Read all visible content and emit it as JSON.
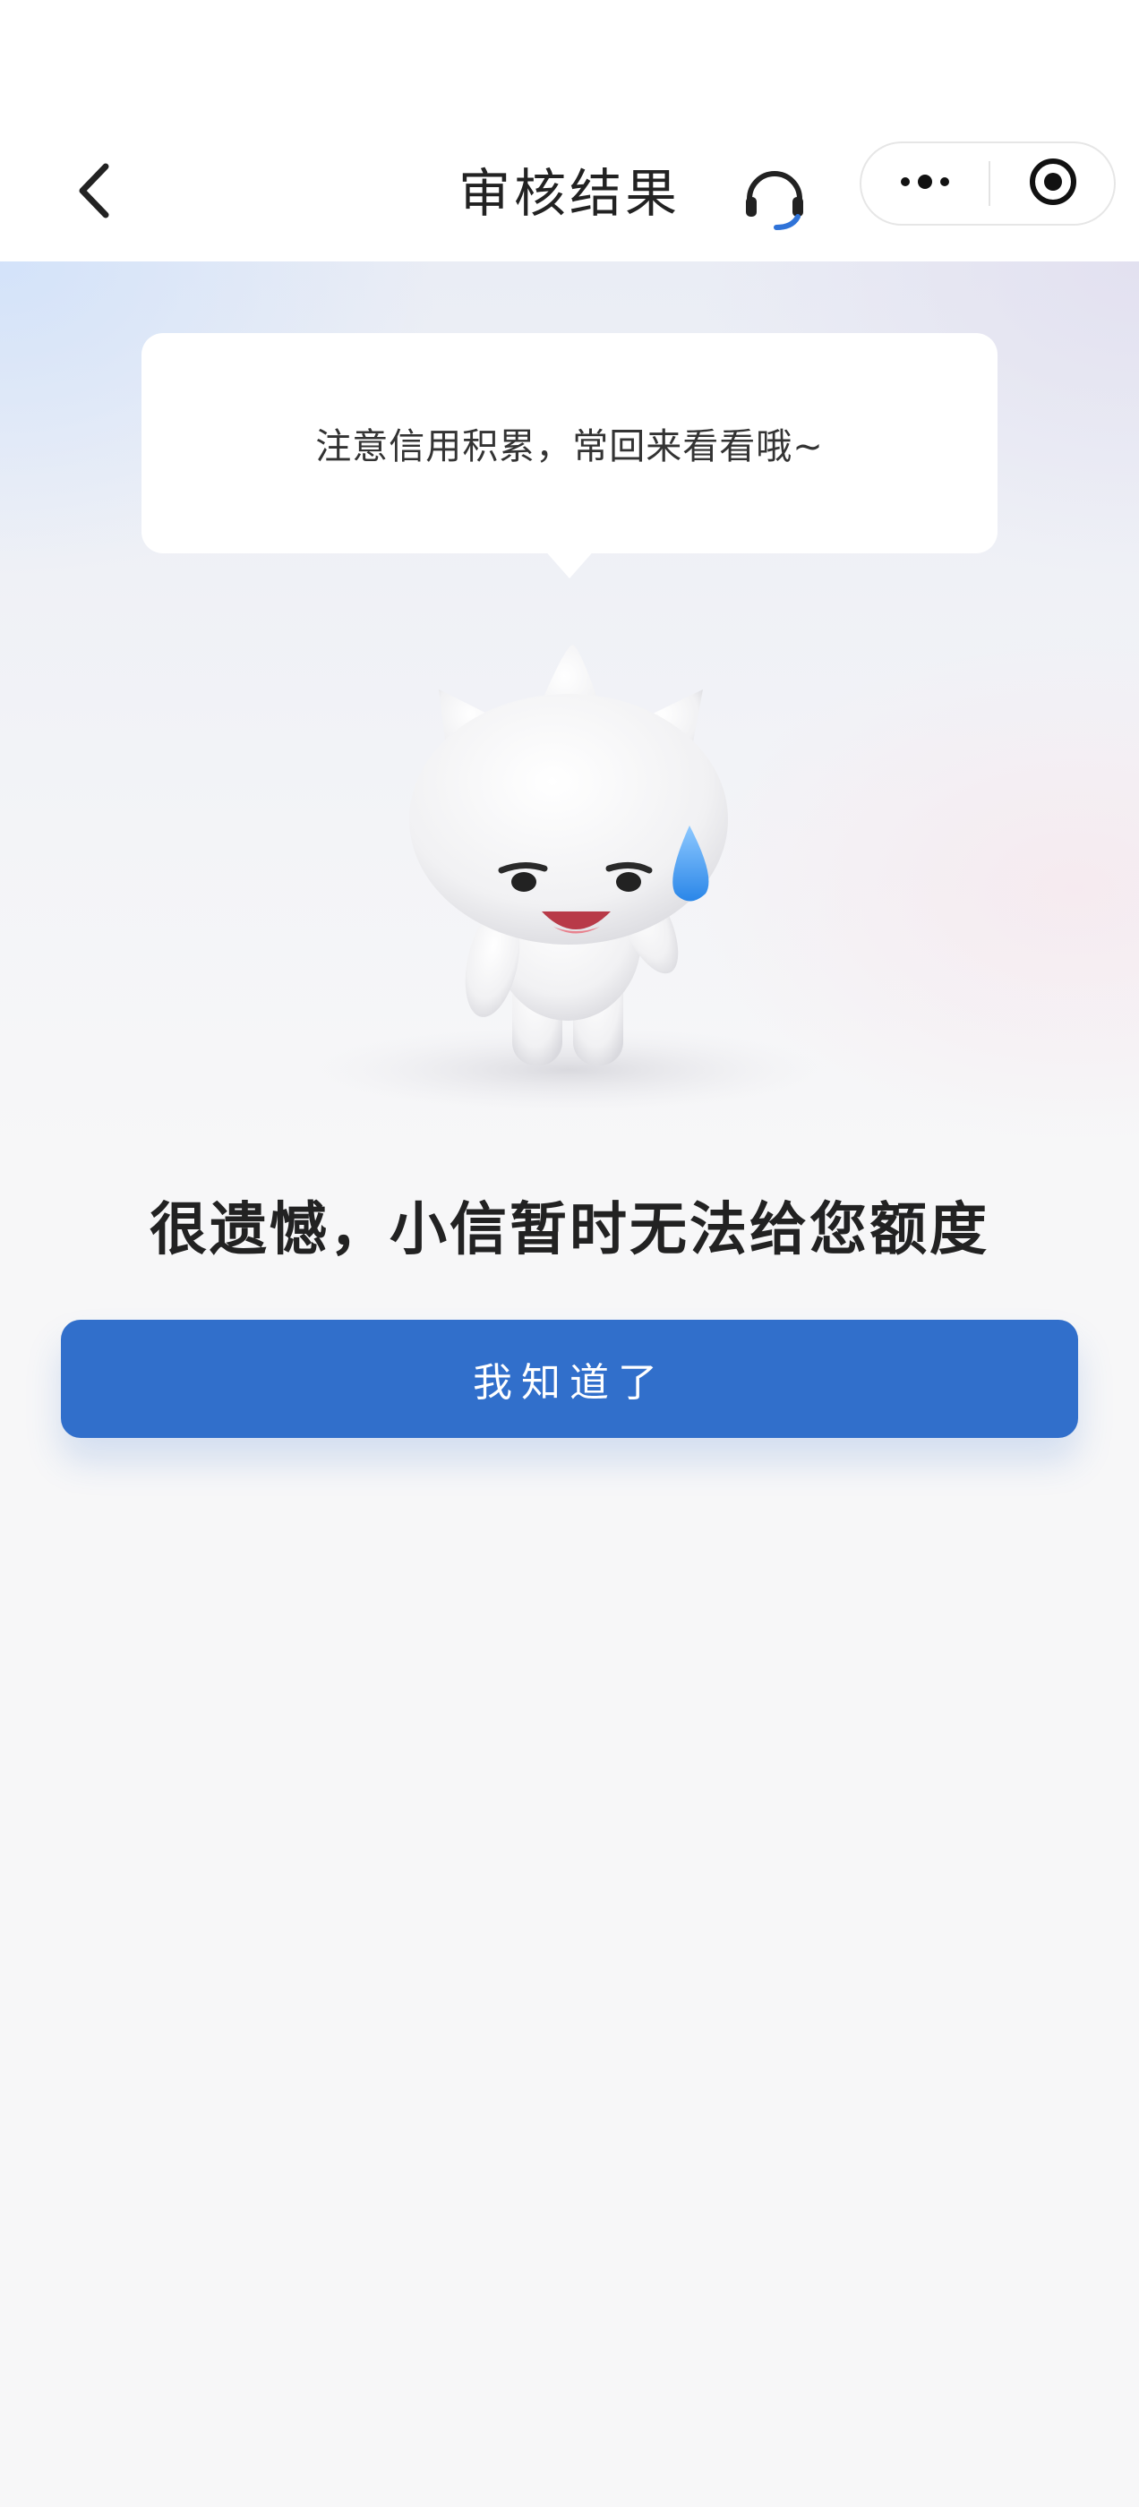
{
  "header": {
    "title": "审核结果",
    "back_icon": "chevron-left-icon",
    "service_icon": "headset-icon",
    "more_icon": "more-dots-icon",
    "close_icon": "target-circle-icon"
  },
  "hero": {
    "bubble_text": "注意信用积累，常回来看看哦~",
    "mascot": "white-cat-mascot-sweat-drop"
  },
  "result": {
    "title": "很遗憾，小信暂时无法给您额度",
    "confirm_button": "我知道了"
  },
  "colors": {
    "primary": "#316fcb",
    "title_text": "#222222",
    "background": "#f7f7f8"
  }
}
